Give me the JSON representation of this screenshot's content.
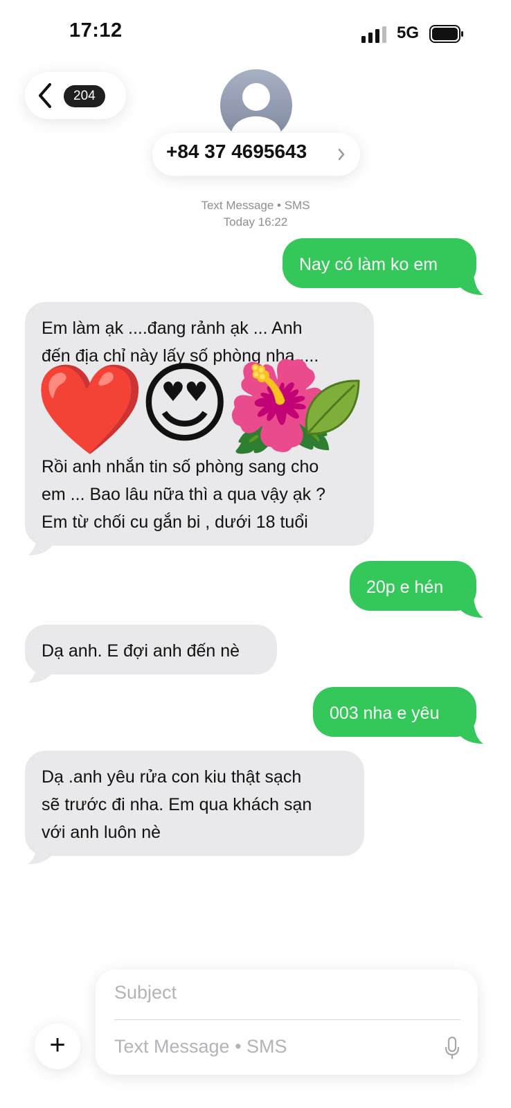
{
  "status_bar": {
    "time": "17:12",
    "network": "5G"
  },
  "header": {
    "back_badge": "204",
    "contact": "+84 37 4695643"
  },
  "thread_meta": {
    "service": "Text Message • SMS",
    "timestamp": "Today 16:22"
  },
  "messages": [
    {
      "side": "sent",
      "text": "Nay có làm ko em"
    },
    {
      "side": "received",
      "lines": [
        "Em làm ạk ....đang rảnh ạk ... Anh",
        "đến địa chỉ này lấy số phòng nha ....",
        "",
        "",
        "",
        "Rồi anh nhắn tin số phòng sang cho",
        "em ... Bao lâu nữa thì a qua vậy ạk ?",
        "Em từ chối cu gắn bi , dưới 18 tuổi"
      ]
    },
    {
      "side": "sent",
      "text": "20p e hén"
    },
    {
      "side": "received",
      "text": "Dạ anh. E đợi anh đến nè"
    },
    {
      "side": "sent",
      "text": "003 nha e yêu"
    },
    {
      "side": "received",
      "lines": [
        "Dạ .anh yêu rửa con kiu thật sạch",
        "sẽ trước đi nha. Em qua khách sạn",
        "với anh luôn nè"
      ]
    }
  ],
  "stickers": [
    "❤️",
    "😍",
    "🌺"
  ],
  "input": {
    "subject_placeholder": "Subject",
    "message_placeholder": "Text Message • SMS"
  },
  "colors": {
    "sent_bubble": "#34c759",
    "received_bubble": "#e9e9eb",
    "meta_text": "#8e8e93"
  },
  "icons": [
    "signal-icon",
    "battery-icon",
    "back-chevron-icon",
    "avatar-icon",
    "chevron-right-icon",
    "plus-icon",
    "mic-icon"
  ]
}
